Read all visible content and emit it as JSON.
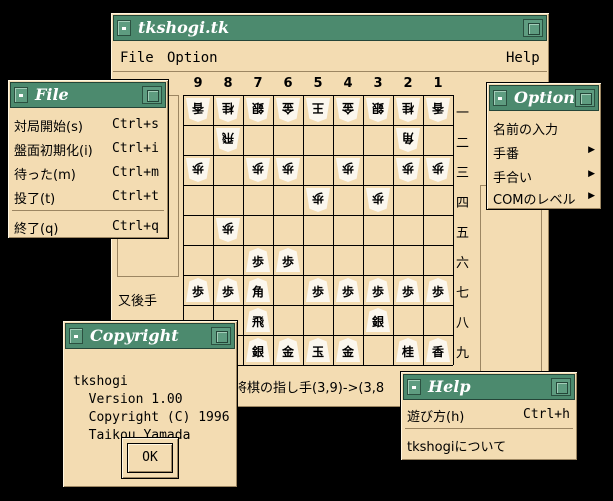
{
  "main": {
    "title": "tkshogi.tk",
    "menu": {
      "file": "File",
      "option": "Option",
      "help": "Help"
    },
    "columns": [
      "9",
      "8",
      "7",
      "6",
      "5",
      "4",
      "3",
      "2",
      "1"
    ],
    "rows": [
      "一",
      "二",
      "三",
      "四",
      "五",
      "六",
      "七",
      "八",
      "九"
    ],
    "board": [
      [
        "香",
        "桂",
        "銀",
        "金",
        "王",
        "金",
        "銀",
        "桂",
        "香"
      ],
      [
        "",
        "飛",
        "",
        "",
        "",
        "",
        "",
        "角",
        ""
      ],
      [
        "歩",
        "",
        "歩",
        "歩",
        "",
        "歩",
        "",
        "歩",
        "歩"
      ],
      [
        "",
        "",
        "",
        "",
        "歩",
        "",
        "歩",
        "",
        ""
      ],
      [
        "",
        "歩",
        "",
        "",
        "",
        "",
        "",
        "",
        ""
      ],
      [
        "",
        "",
        "歩",
        "歩",
        "",
        "",
        "",
        "",
        ""
      ],
      [
        "歩",
        "歩",
        "角",
        "",
        "歩",
        "歩",
        "歩",
        "歩",
        "歩"
      ],
      [
        "",
        "",
        "飛",
        "",
        "",
        "",
        "銀",
        "",
        ""
      ],
      [
        "",
        "",
        "銀",
        "金",
        "玉",
        "金",
        "",
        "桂",
        "香"
      ]
    ],
    "gote": [
      [
        1,
        1,
        1,
        1,
        1,
        1,
        1,
        1,
        1
      ],
      [
        0,
        1,
        0,
        0,
        0,
        0,
        0,
        1,
        0
      ],
      [
        1,
        0,
        1,
        1,
        0,
        1,
        0,
        1,
        1
      ],
      [
        0,
        0,
        0,
        0,
        1,
        0,
        1,
        0,
        0
      ],
      [
        0,
        1,
        0,
        0,
        0,
        0,
        0,
        0,
        0
      ],
      [
        0,
        0,
        0,
        0,
        0,
        0,
        0,
        0,
        0
      ],
      [
        0,
        0,
        0,
        0,
        0,
        0,
        0,
        0,
        0
      ],
      [
        0,
        0,
        0,
        0,
        0,
        0,
        0,
        0,
        0
      ],
      [
        0,
        0,
        0,
        0,
        0,
        0,
        0,
        0,
        0
      ]
    ],
    "turn_label": "又後手",
    "status": "将棋の指し手(3,9)->(3,8"
  },
  "file_menu": {
    "title": "File",
    "items": [
      {
        "label": "対局開始(s)",
        "accel": "Ctrl+s"
      },
      {
        "label": "盤面初期化(i)",
        "accel": "Ctrl+i"
      },
      {
        "label": "待った(m)",
        "accel": "Ctrl+m"
      },
      {
        "label": "投了(t)",
        "accel": "Ctrl+t"
      },
      {
        "label": "終了(q)",
        "accel": "Ctrl+q"
      }
    ]
  },
  "option_menu": {
    "title": "Option",
    "items": [
      "名前の入力",
      "手番",
      "手合い",
      "COMのレベル"
    ]
  },
  "copyright": {
    "title": "Copyright",
    "lines": [
      "tkshogi",
      "  Version 1.00",
      "  Copyright (C) 1996",
      "  Taikou Yamada"
    ],
    "ok": "OK"
  },
  "help_menu": {
    "title": "Help",
    "items": [
      {
        "label": "遊び方(h)",
        "accel": "Ctrl+h"
      },
      {
        "label": "tkshogiについて",
        "accel": ""
      }
    ]
  },
  "colors": {
    "frame": "#4c8a6e",
    "bg": "#f3dcb2",
    "desktop": "#000000"
  }
}
